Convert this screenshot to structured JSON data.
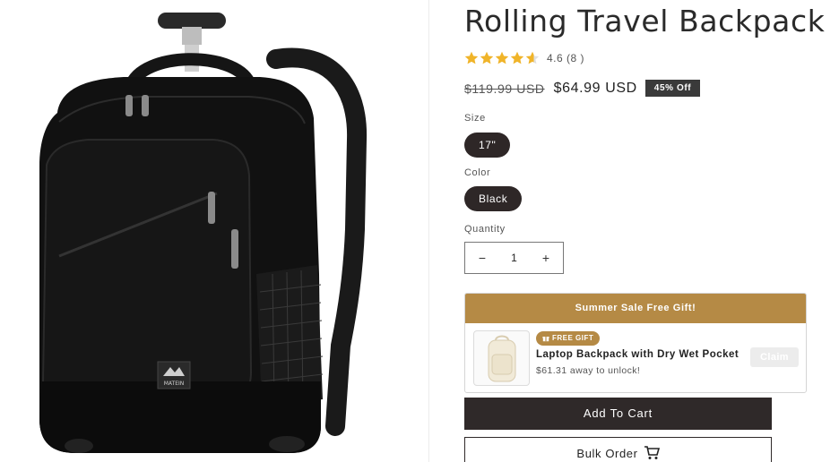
{
  "product": {
    "title": "Rolling Travel Backpack",
    "rating": {
      "value": 4.6,
      "text": "4.6 (8 )",
      "stars_full": 4,
      "stars_partial": 0.6,
      "star_color": "#f0b429"
    },
    "price": {
      "old": "$119.99 USD",
      "new": "$64.99 USD",
      "discount_badge": "45% Off"
    },
    "brand_mark": "MATEIN"
  },
  "options": {
    "size": {
      "label": "Size",
      "selected": "17\""
    },
    "color": {
      "label": "Color",
      "selected": "Black"
    }
  },
  "quantity": {
    "label": "Quantity",
    "value": "1",
    "minus_icon": "minus-icon",
    "plus_icon": "plus-icon"
  },
  "gift": {
    "header": "Summer Sale Free Gift!",
    "tag": "FREE GIFT",
    "name": "Laptop Backpack with Dry Wet Pocket",
    "progress": "$61.31 away to unlock!",
    "claim_label": "Claim",
    "accent_color": "#b58a45"
  },
  "actions": {
    "add_to_cart": "Add To Cart",
    "bulk_order": "Bulk Order",
    "bulk_icon": "cart-icon"
  }
}
